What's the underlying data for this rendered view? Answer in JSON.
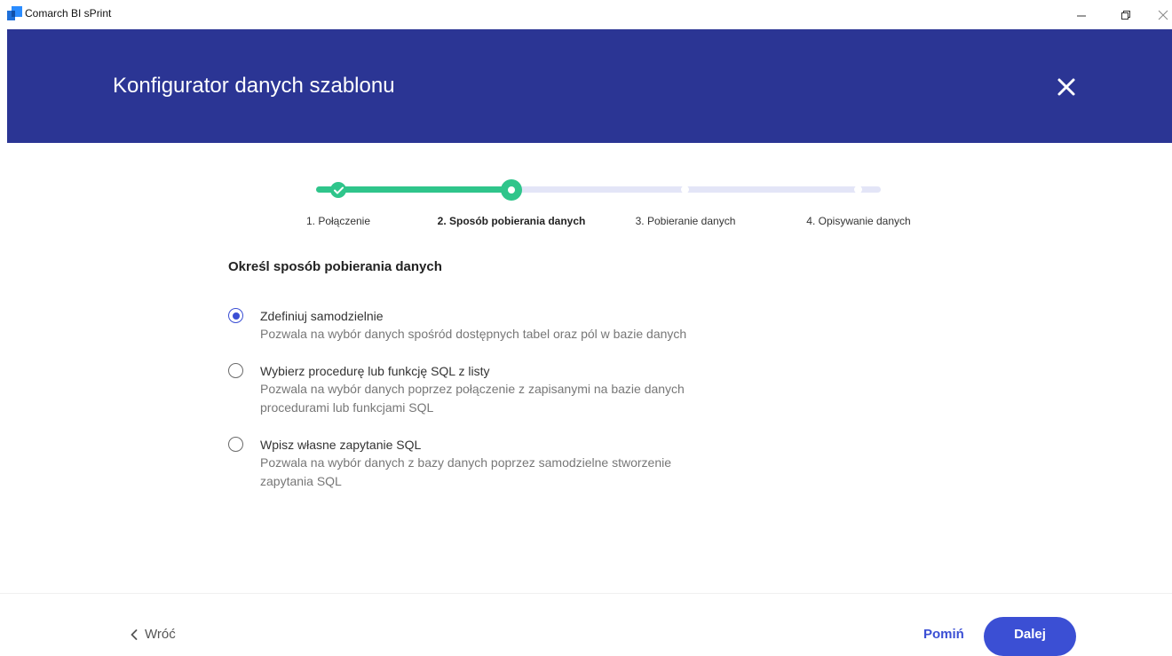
{
  "window": {
    "title": "Comarch BI sPrint",
    "icon": "app-logo-icon"
  },
  "header": {
    "title": "Konfigurator danych szablonu",
    "close_icon": "close-icon"
  },
  "stepper": {
    "steps": [
      {
        "label": "1. Połączenie",
        "state": "done"
      },
      {
        "label": "2. Sposób pobierania danych",
        "state": "active"
      },
      {
        "label": "3. Pobieranie danych",
        "state": "pending"
      },
      {
        "label": "4. Opisywanie danych",
        "state": "pending"
      }
    ]
  },
  "main": {
    "section_title": "Określ sposób pobierania danych",
    "options": [
      {
        "title": "Zdefiniuj samodzielnie",
        "description": "Pozwala na wybór danych spośród dostępnych tabel oraz pól w bazie danych",
        "selected": true
      },
      {
        "title": "Wybierz procedurę lub funkcję SQL z listy",
        "description": "Pozwala na wybór danych poprzez połączenie z zapisanymi na bazie danych procedurami lub funkcjami SQL",
        "selected": false
      },
      {
        "title": "Wpisz własne zapytanie SQL",
        "description": "Pozwala na wybór danych z bazy danych poprzez samodzielne stworzenie zapytania SQL",
        "selected": false
      }
    ]
  },
  "footer": {
    "back_label": "Wróć",
    "skip_label": "Pomiń",
    "next_label": "Dalej"
  },
  "colors": {
    "header_bg": "#2b3594",
    "accent": "#3b4fd4",
    "progress": "#2fc58b",
    "track": "#e3e5f7"
  }
}
